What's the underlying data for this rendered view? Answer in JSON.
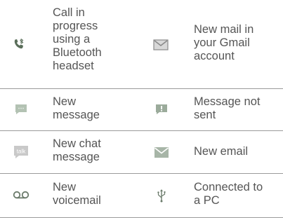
{
  "rows": [
    {
      "left": {
        "icon": "bluetooth-call-icon",
        "lines": [
          "Call in",
          "progress",
          "using a",
          "Bluetooth",
          "headset"
        ]
      },
      "right": {
        "icon": "gmail-icon",
        "lines": [
          "New mail in",
          "your Gmail",
          "account"
        ]
      }
    },
    {
      "left": {
        "icon": "message-icon",
        "lines": [
          "New",
          "message"
        ]
      },
      "right": {
        "icon": "message-not-sent-icon",
        "lines": [
          "Message not",
          "sent"
        ]
      }
    },
    {
      "left": {
        "icon": "talk-chat-icon",
        "icon_text": "talk",
        "lines": [
          "New chat",
          "message"
        ]
      },
      "right": {
        "icon": "email-icon",
        "lines": [
          "New email"
        ]
      }
    },
    {
      "left": {
        "icon": "voicemail-icon",
        "lines": [
          "New",
          "voicemail"
        ]
      },
      "right": {
        "icon": "usb-icon",
        "lines": [
          "Connected to",
          "a PC"
        ]
      }
    }
  ]
}
